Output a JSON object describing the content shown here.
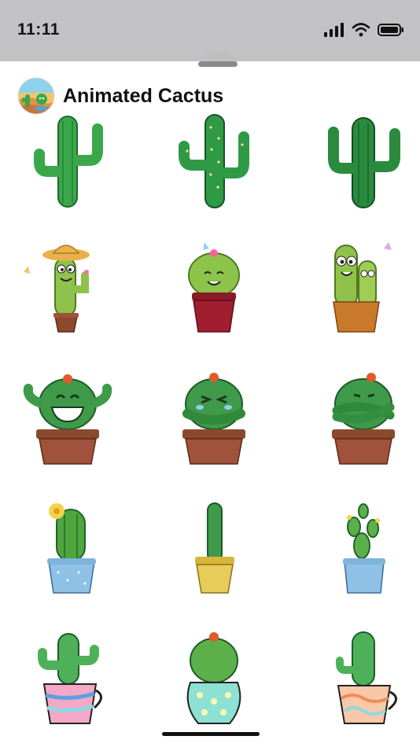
{
  "status_bar": {
    "time": "11:11",
    "icons": [
      "signal-icon",
      "wifi-icon",
      "battery-icon"
    ]
  },
  "header": {
    "title": "Animated Cactus",
    "avatar_icon": "desert-cactus-avatar"
  },
  "stickers": [
    {
      "name": "tall-saguaro-cactus"
    },
    {
      "name": "dotted-saguaro-cactus"
    },
    {
      "name": "dark-saguaro-cactus"
    },
    {
      "name": "cactus-with-straw-hat"
    },
    {
      "name": "smiling-cactus-in-red-pot"
    },
    {
      "name": "googly-eyed-cactus-pair"
    },
    {
      "name": "grinning-cactus-in-pot"
    },
    {
      "name": "laughing-cactus-in-pot"
    },
    {
      "name": "arms-crossed-cactus-in-pot"
    },
    {
      "name": "flowering-cactus-blue-pot"
    },
    {
      "name": "tall-cactus-gold-pot"
    },
    {
      "name": "prickly-pear-blue-pot"
    },
    {
      "name": "cactus-in-striped-cup"
    },
    {
      "name": "round-cactus-polka-pot"
    },
    {
      "name": "cactus-in-patterned-cup"
    }
  ],
  "colors": {
    "cactus_green": "#3aa84a",
    "cactus_dark": "#1f7a33",
    "pot_brown": "#a0523d",
    "pot_red": "#8a1a28",
    "pot_blue": "#8fc1e6",
    "pot_gold": "#e0c24a"
  }
}
